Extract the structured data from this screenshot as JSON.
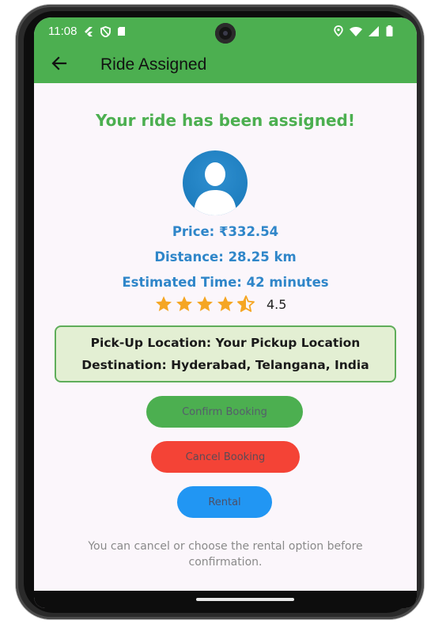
{
  "status_bar": {
    "time": "11:08",
    "left_icons": [
      "flutter-icon",
      "shield-icon",
      "sd-card-icon"
    ],
    "right_icons": [
      "location-icon",
      "wifi-icon",
      "signal-icon",
      "battery-icon"
    ]
  },
  "app_bar": {
    "title": "Ride Assigned",
    "back_icon": "arrow-left-icon",
    "background": "#4caf50"
  },
  "main": {
    "headline": "Your ride has been assigned!",
    "avatar_icon": "person-icon",
    "price": "Price: ₹332.54",
    "distance": "Distance: 28.25 km",
    "estimated_time": "Estimated Time: 42 minutes",
    "rating": {
      "value": "4.5",
      "stars_full": 4,
      "stars_half": 1,
      "star_color": "#f5a623"
    },
    "locations": {
      "pickup": "Pick-Up Location: Your Pickup Location",
      "destination": "Destination: Hyderabad, Telangana, India"
    },
    "buttons": {
      "confirm": "Confirm Booking",
      "cancel": "Cancel Booking",
      "rental": "Rental"
    },
    "footnote": "You can cancel or choose the rental option before confirmation."
  },
  "colors": {
    "accent_green": "#4caf50",
    "info_blue": "#2f86c9",
    "cancel_red": "#f44336",
    "rental_blue": "#2196f3"
  }
}
